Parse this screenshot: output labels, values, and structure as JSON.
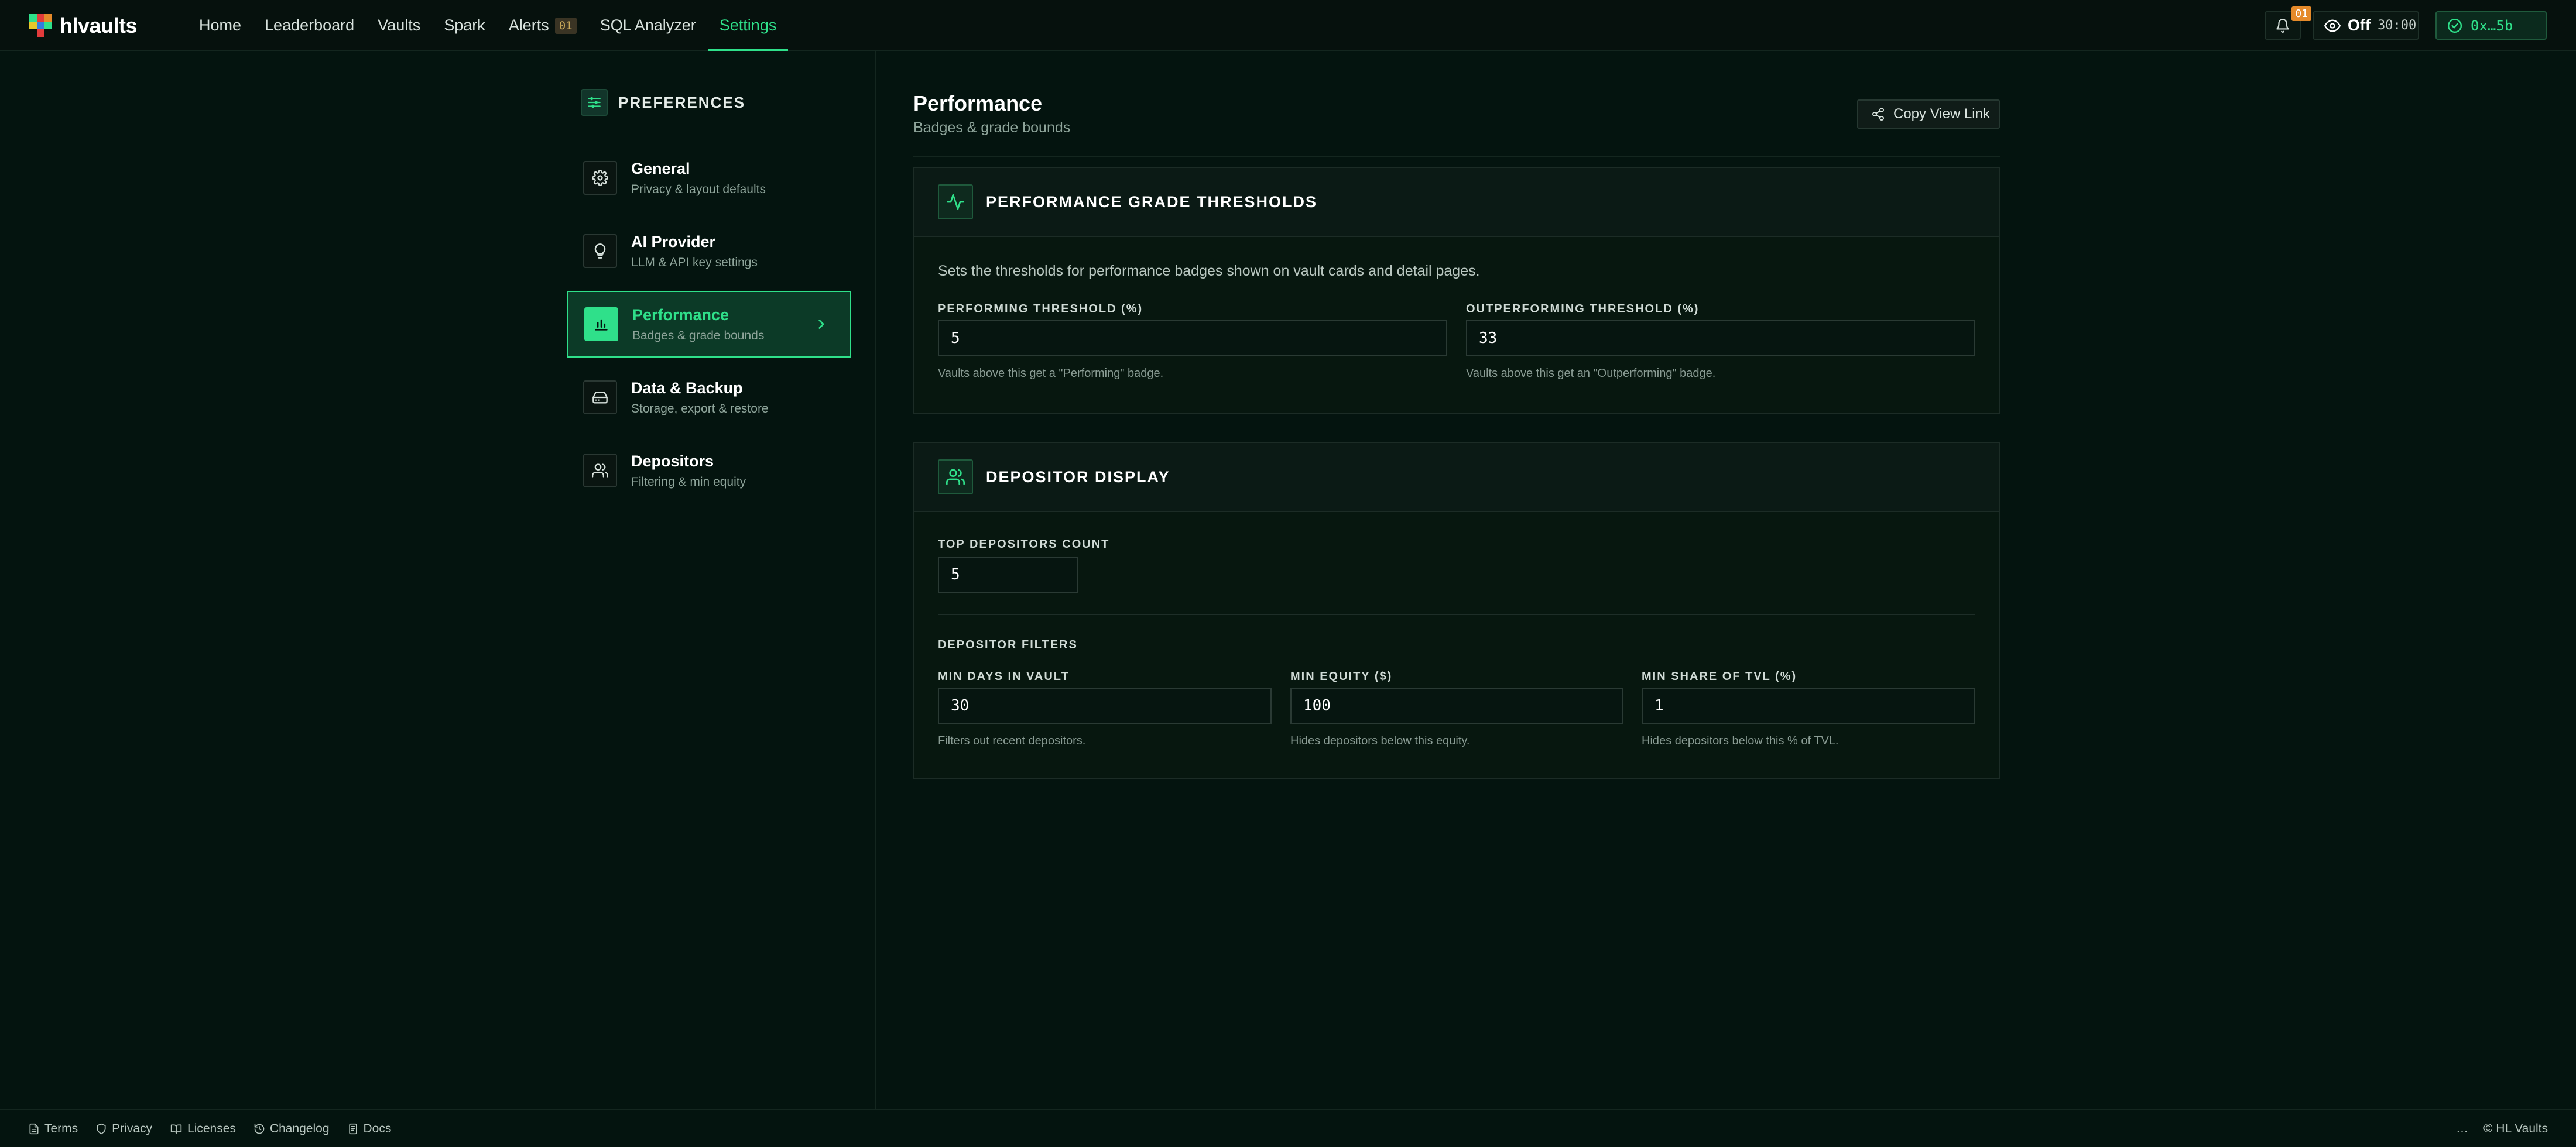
{
  "brand": {
    "name": "hlvaults",
    "colors": {
      "accent": "#2fe08a",
      "bg": "#04140f",
      "warn": "#e58a2a"
    }
  },
  "nav": {
    "items": [
      {
        "label": "Home"
      },
      {
        "label": "Leaderboard"
      },
      {
        "label": "Vaults"
      },
      {
        "label": "Spark"
      },
      {
        "label": "Alerts",
        "badge": "01"
      },
      {
        "label": "SQL Analyzer"
      },
      {
        "label": "Settings",
        "active": true
      }
    ]
  },
  "topbar": {
    "bell_icon": "bell-icon",
    "bell_badge": "01",
    "view_mode_icon": "eye-icon",
    "view_mode": "Off",
    "view_timer": "30:00",
    "wallet_icon": "check-circle-icon",
    "wallet": "0x…5b"
  },
  "sidebar": {
    "title": "PREFERENCES",
    "title_icon": "sliders-icon",
    "items": [
      {
        "label": "General",
        "sub": "Privacy & layout defaults",
        "icon": "gear-icon"
      },
      {
        "label": "AI Provider",
        "sub": "LLM & API key settings",
        "icon": "lightbulb-icon"
      },
      {
        "label": "Performance",
        "sub": "Badges & grade bounds",
        "icon": "bar-chart-icon",
        "active": true
      },
      {
        "label": "Data & Backup",
        "sub": "Storage, export & restore",
        "icon": "hard-drive-icon"
      },
      {
        "label": "Depositors",
        "sub": "Filtering & min equity",
        "icon": "users-icon"
      }
    ]
  },
  "main": {
    "title": "Performance",
    "subtitle": "Badges & grade bounds",
    "copy_link_label": "Copy View Link",
    "copy_link_icon": "share-icon",
    "grade_card": {
      "title": "PERFORMANCE GRADE THRESHOLDS",
      "icon": "activity-icon",
      "description": "Sets the thresholds for performance badges shown on vault cards and detail pages.",
      "performing": {
        "label": "PERFORMING THRESHOLD (%)",
        "value": "5",
        "hint": "Vaults above this get a \"Performing\" badge."
      },
      "outperforming": {
        "label": "OUTPERFORMING THRESHOLD (%)",
        "value": "33",
        "hint": "Vaults above this get an \"Outperforming\" badge."
      }
    },
    "depositor_card": {
      "title": "DEPOSITOR DISPLAY",
      "icon": "users-icon",
      "top_count": {
        "label": "TOP DEPOSITORS COUNT",
        "value": "5"
      },
      "filters_heading": "DEPOSITOR FILTERS",
      "min_days": {
        "label": "MIN DAYS IN VAULT",
        "value": "30",
        "hint": "Filters out recent depositors."
      },
      "min_equity": {
        "label": "MIN EQUITY ($)",
        "value": "100",
        "hint": "Hides depositors below this equity."
      },
      "min_share": {
        "label": "MIN SHARE OF TVL (%)",
        "value": "1",
        "hint": "Hides depositors below this % of TVL."
      }
    }
  },
  "footer": {
    "links": [
      {
        "label": "Terms",
        "icon": "file-icon"
      },
      {
        "label": "Privacy",
        "icon": "shield-icon"
      },
      {
        "label": "Licenses",
        "icon": "book-icon"
      },
      {
        "label": "Changelog",
        "icon": "history-icon"
      },
      {
        "label": "Docs",
        "icon": "doc-icon"
      }
    ],
    "dots": "…",
    "copyright": "© HL Vaults"
  }
}
